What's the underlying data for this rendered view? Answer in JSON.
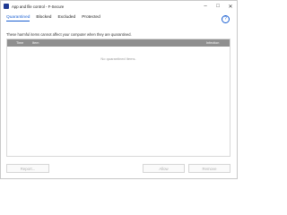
{
  "window": {
    "title": "App and file control - F-Secure",
    "controls": {
      "minimize": "–",
      "maximize": "□",
      "close": "✕"
    }
  },
  "tabs": [
    {
      "label": "Quarantined",
      "active": true
    },
    {
      "label": "Blocked",
      "active": false
    },
    {
      "label": "Excluded",
      "active": false
    },
    {
      "label": "Protected",
      "active": false
    }
  ],
  "help": {
    "label": "?"
  },
  "description": "These harmful items cannot affect your computer when they are quarantined.",
  "table": {
    "columns": [
      "Time",
      "Item",
      "Infection"
    ],
    "empty_text": "No quarantined items."
  },
  "buttons": {
    "report": "Report...",
    "allow": "Allow",
    "remove": "Remove"
  },
  "colors": {
    "accent": "#1a5fd1",
    "header_bg": "#8f8f8f",
    "app_icon": "#1f3a93"
  }
}
